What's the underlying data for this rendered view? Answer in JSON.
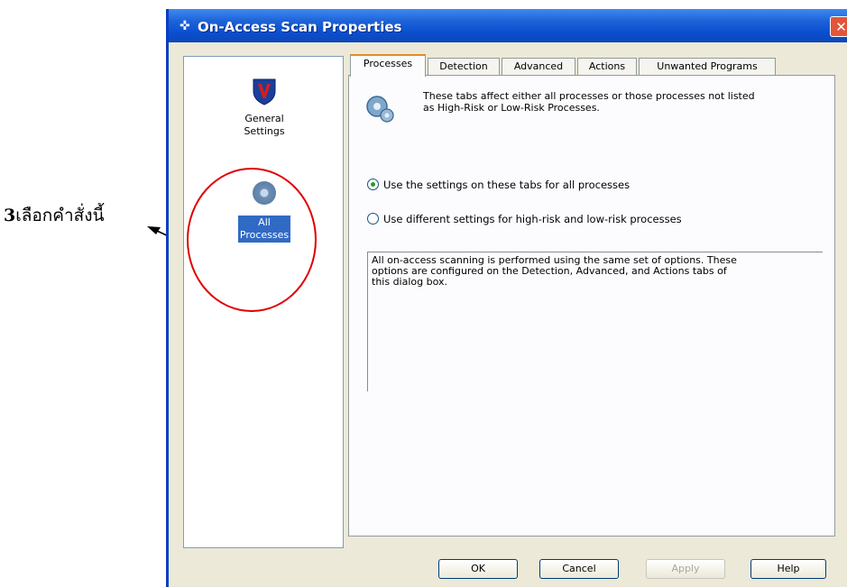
{
  "annotation": {
    "number": "3",
    "text": "เลือกคำสั่งนี้"
  },
  "window": {
    "title": "On-Access Scan Properties",
    "close_label": "✕"
  },
  "nav": {
    "items": [
      {
        "label_line1": "General",
        "label_line2": "Settings",
        "icon": "shield-v-icon",
        "selected": false
      },
      {
        "label_line1": "All",
        "label_line2": "Processes",
        "icon": "cd-icon",
        "selected": true
      }
    ]
  },
  "tabs": [
    "Processes",
    "Detection",
    "Advanced",
    "Actions",
    "Unwanted Programs"
  ],
  "active_tab": "Processes",
  "panel": {
    "info_line1": "These tabs affect either all processes or those processes not listed",
    "info_line2": "as High-Risk or Low-Risk Processes.",
    "radio_all": "Use the settings on these tabs for all processes",
    "radio_different": "Use different settings for high-risk and low-risk processes",
    "description_line1": "All on-access scanning is performed using the same set of options. These",
    "description_line2": "options are configured on the Detection, Advanced, and Actions tabs of",
    "description_line3": "this dialog box."
  },
  "buttons": {
    "ok": "OK",
    "cancel": "Cancel",
    "apply": "Apply",
    "help": "Help"
  },
  "colors": {
    "titlebar": "#0a4fd0",
    "selection": "#316ac5",
    "annotation_circle": "#e00000",
    "active_tab_accent": "#e68b2c"
  }
}
